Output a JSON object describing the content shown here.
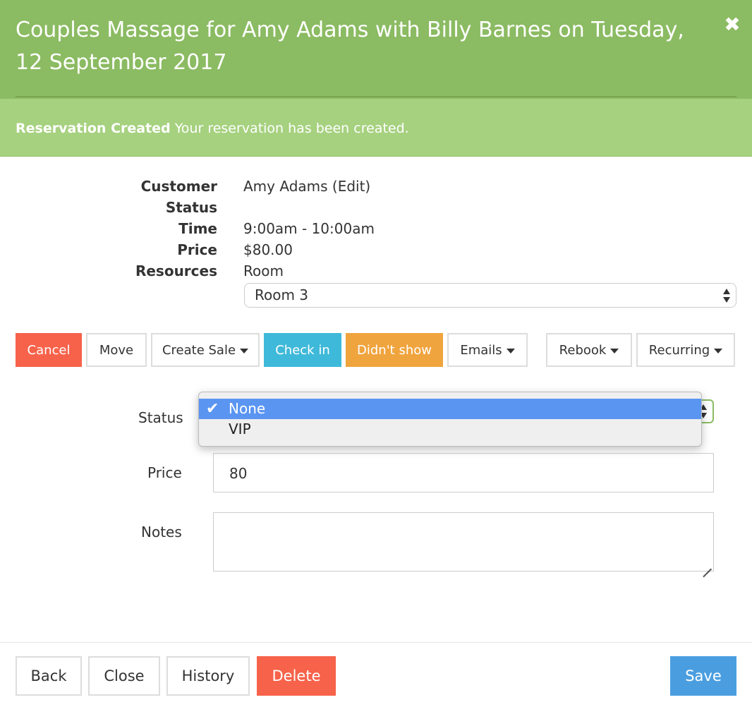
{
  "header": {
    "title": "Couples Massage for Amy Adams with Billy Barnes on Tuesday, 12 September 2017",
    "close_label": "✖"
  },
  "alert": {
    "heading": "Reservation Created",
    "message": "Your reservation has been created."
  },
  "info": {
    "customer_label": "Customer",
    "customer_value": "Amy Adams (Edit)",
    "status_label": "Status",
    "status_value": "",
    "time_label": "Time",
    "time_value": "9:00am - 10:00am",
    "price_label": "Price",
    "price_value": "$80.00",
    "resources_label": "Resources",
    "resources_value": "Room",
    "room_selected": "Room 3"
  },
  "actions": {
    "cancel": "Cancel",
    "move": "Move",
    "create_sale": "Create Sale",
    "check_in": "Check in",
    "didnt_show": "Didn't show",
    "emails": "Emails",
    "rebook": "Rebook",
    "recurring": "Recurring"
  },
  "form": {
    "status_label": "Status",
    "status_options": [
      "None",
      "VIP"
    ],
    "status_selected": "None",
    "price_label": "Price",
    "price_value": "80",
    "notes_label": "Notes",
    "notes_value": ""
  },
  "footer": {
    "back": "Back",
    "close": "Close",
    "history": "History",
    "delete": "Delete",
    "save": "Save"
  },
  "colors": {
    "header": "#8bbb62",
    "alert": "#a6d17f",
    "danger": "#f7624a",
    "info": "#3fb9d9",
    "warning": "#f0a43e",
    "primary": "#4a9ee0",
    "highlight": "#5b95f2"
  }
}
